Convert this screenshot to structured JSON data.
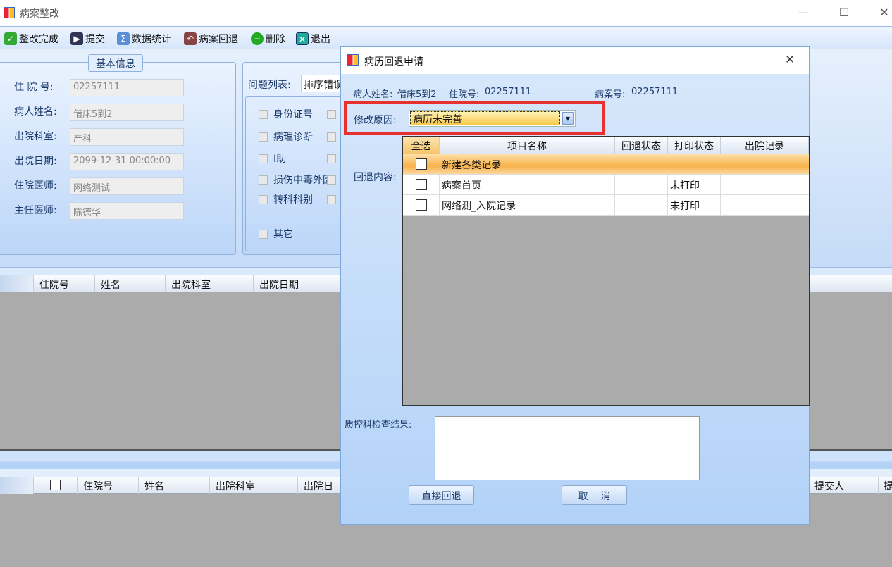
{
  "window": {
    "title": "病案整改",
    "minimize": "—",
    "maximize": "☐",
    "close": "✕"
  },
  "toolbar": [
    {
      "label": "整改完成",
      "icon": "check-icon"
    },
    {
      "label": "提交",
      "icon": "submit-icon"
    },
    {
      "label": "数据统计",
      "icon": "sigma-icon"
    },
    {
      "label": "病案回退",
      "icon": "rollback-icon"
    },
    {
      "label": "删除",
      "icon": "delete-icon"
    },
    {
      "label": "退出",
      "icon": "exit-icon"
    }
  ],
  "basic_info": {
    "title": "基本信息",
    "fields": [
      {
        "label": "住 院 号:",
        "value": "02257111"
      },
      {
        "label": "病人姓名:",
        "value": "借床5到2"
      },
      {
        "label": "出院科室:",
        "value": "产科"
      },
      {
        "label": "出院日期:",
        "value": "2099-12-31 00:00:00"
      },
      {
        "label": "住院医师:",
        "value": "网络测试"
      },
      {
        "label": "主任医师:",
        "value": "陈德华"
      }
    ]
  },
  "problems": {
    "label": "问题列表:",
    "selected": "排序错误",
    "items": [
      "身份证号",
      "病理诊断",
      "I助",
      "损伤中毒外因",
      "转科科别",
      "其它"
    ]
  },
  "top_grid": {
    "columns": [
      "住院号",
      "姓名",
      "出院科室",
      "出院日期"
    ]
  },
  "bottom_grid": {
    "columns": [
      "住院号",
      "姓名",
      "出院科室",
      "出院日期"
    ],
    "right_columns": [
      "提交人",
      "提"
    ]
  },
  "dialog": {
    "title": "病历回退申请",
    "close": "✕",
    "patient_name_label": "病人姓名:",
    "patient_name": "借床5到2",
    "inpatient_no_label": "住院号:",
    "inpatient_no": "02257111",
    "case_no_label": "病案号:",
    "case_no": "02257111",
    "reason_label": "修改原因:",
    "reason_value": "病历未完善",
    "content_label": "回退内容:",
    "columns": [
      "全选",
      "项目名称",
      "回退状态",
      "打印状态",
      "出院记录"
    ],
    "rows": [
      {
        "name": "新建各类记录",
        "rollback": "",
        "print": "",
        "discharge": "",
        "group": true
      },
      {
        "name": "病案首页",
        "rollback": "",
        "print": "未打印",
        "discharge": ""
      },
      {
        "name": "网络测_入院记录",
        "rollback": "",
        "print": "未打印",
        "discharge": ""
      }
    ],
    "qc_label": "质控科检查结果:",
    "qc_value": "",
    "direct_button": "直接回退",
    "cancel_button": "取    消"
  },
  "colors": {
    "highlight_border": "#e8302f",
    "selected_row": "#fbb54a",
    "grid_bg": "#ababab"
  }
}
